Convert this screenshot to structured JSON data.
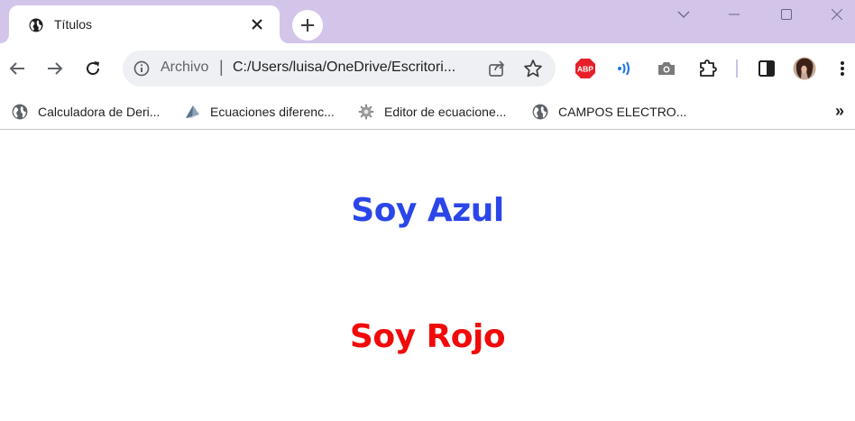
{
  "browser": {
    "tab": {
      "title": "Títulos",
      "favicon": "globe-icon"
    },
    "new_tab_icon": "plus-icon",
    "window_controls": [
      "chevron-down-icon",
      "minimize-icon",
      "maximize-icon",
      "close-icon"
    ],
    "address_bar": {
      "scheme_label": "Archivo",
      "separator": "|",
      "url": "C:/Users/luisa/OneDrive/Escritori..."
    },
    "extensions": [
      "adblock-plus-icon",
      "wave-icon",
      "camera-icon",
      "puzzle-icon",
      "side-panel-icon",
      "avatar"
    ],
    "adblock_label": "ABP"
  },
  "bookmarks": {
    "items": [
      {
        "label": "Calculadora de Deri...",
        "icon": "globe-icon"
      },
      {
        "label": "Ecuaciones diferenc...",
        "icon": "wedge-icon"
      },
      {
        "label": "Editor de ecuacione...",
        "icon": "gear-icon"
      },
      {
        "label": "CAMPOS ELECTRO...",
        "icon": "globe-icon"
      }
    ],
    "overflow": "»"
  },
  "page": {
    "headings": [
      {
        "text": "Soy Azul",
        "color": "#2b46e8"
      },
      {
        "text": "Soy Rojo",
        "color": "#f10a0a"
      }
    ]
  },
  "colors": {
    "titlebar": "#d3c5ea",
    "omnibox": "#eef0f4"
  }
}
